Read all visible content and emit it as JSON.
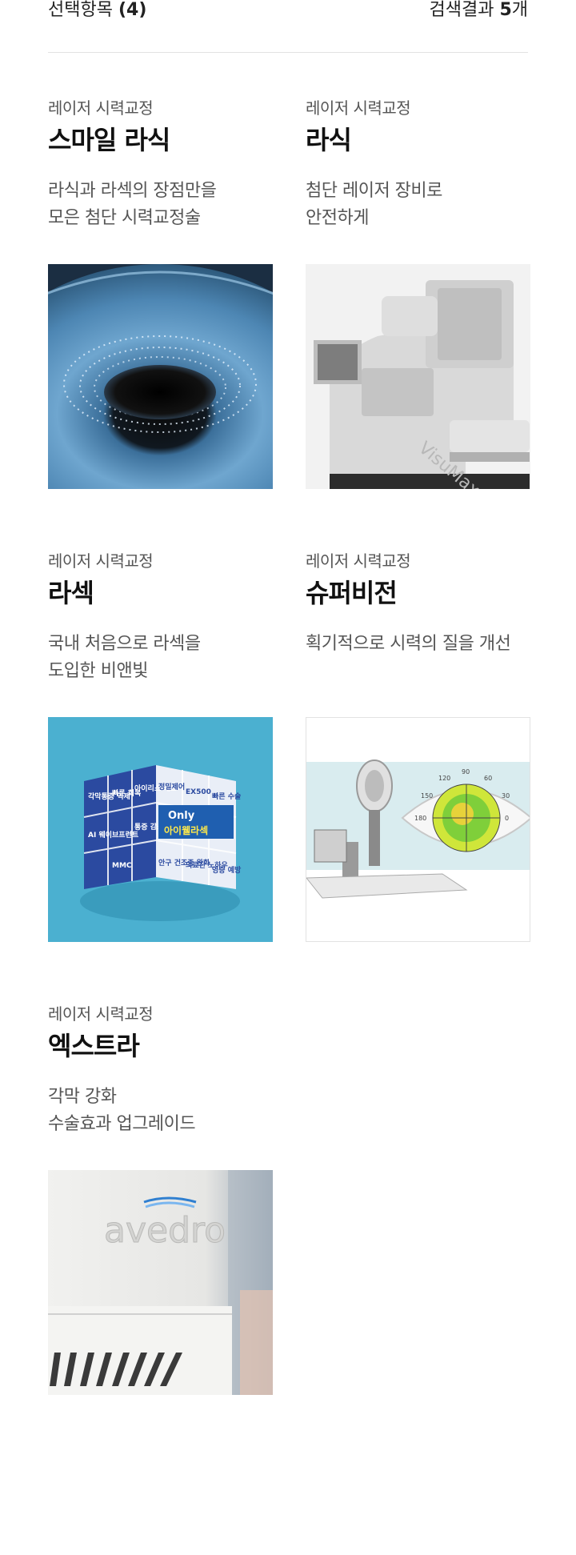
{
  "summary": {
    "selected_label": "선택항목",
    "selected_count": "(4)",
    "result_label": "검색결과",
    "result_count": "5",
    "result_unit": "개"
  },
  "cards": [
    {
      "category": "레이저 시력교정",
      "title": "스마일 라식",
      "desc_line1": "라식과 라섹의 장점만을",
      "desc_line2": "모은 첨단 시력교정술",
      "image": "eye-closeup-laser-image"
    },
    {
      "category": "레이저 시력교정",
      "title": "라식",
      "desc_line1": "첨단 레이저 장비로",
      "desc_line2": "안전하게",
      "image": "visumax-laser-machine-image",
      "image_text": "VisuMax"
    },
    {
      "category": "레이저 시력교정",
      "title": "라섹",
      "desc_line1": "국내 처음으로 라섹을",
      "desc_line2": "도입한 비앤빛",
      "image": "cube-infographic-image",
      "image_text": {
        "only": "Only",
        "brand": "아이웰라섹",
        "cells": [
          "각막통증 억제",
          "빠른 회복",
          "아이리스 레드",
          "정밀제어",
          "EX500",
          "빠른 수술",
          "AI 웨이브프런트",
          "통증 감소",
          "MMC",
          "안구 건조증 완화",
          "의료진 노하우",
          "영증 예방"
        ]
      }
    },
    {
      "category": "레이저 시력교정",
      "title": "슈퍼비전",
      "desc_line1": "획기적으로 시력의 질을 개선",
      "desc_line2": "",
      "image": "topography-device-image",
      "image_text": {
        "dial": [
          "120",
          "90",
          "60",
          "150",
          "30",
          "180",
          "0"
        ]
      }
    },
    {
      "category": "레이저 시력교정",
      "title": "엑스트라",
      "desc_line1": "각막 강화",
      "desc_line2": "수술효과 업그레이드",
      "image": "avedro-device-image",
      "image_text": "avedro"
    }
  ],
  "colors": {
    "text": "#222222",
    "muted": "#555555",
    "divider": "#e2e2e2",
    "teal_bg": "#4bb0d0",
    "cube_blue": "#2b4aa0"
  }
}
